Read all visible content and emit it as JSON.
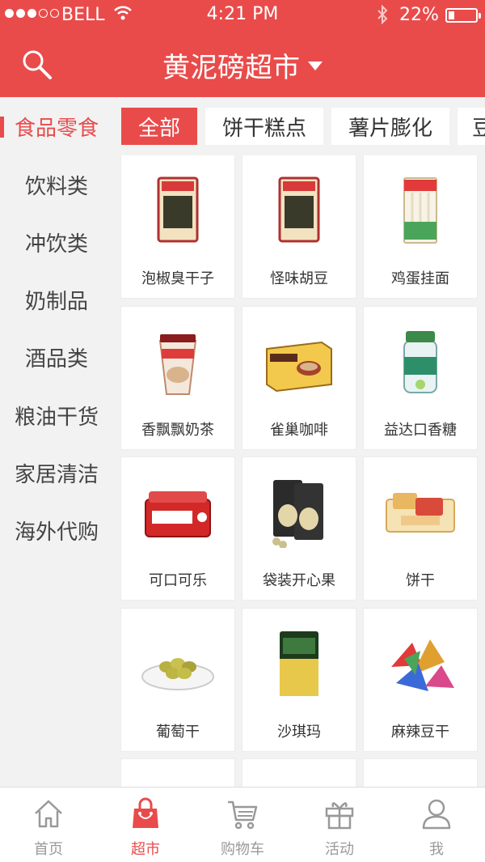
{
  "status_bar": {
    "carrier": "BELL",
    "time": "4:21 PM",
    "battery": "22%",
    "battery_level": 0.22
  },
  "header": {
    "title": "黄泥磅超市",
    "search_icon": "search-icon",
    "dropdown_icon": "caret-down-icon"
  },
  "colors": {
    "accent": "#e94b4b"
  },
  "sidebar": {
    "items": [
      {
        "label": "食品零食",
        "active": true
      },
      {
        "label": "饮料类"
      },
      {
        "label": "冲饮类"
      },
      {
        "label": "奶制品"
      },
      {
        "label": "酒品类"
      },
      {
        "label": "粮油干货"
      },
      {
        "label": "家居清洁"
      },
      {
        "label": "海外代购"
      }
    ]
  },
  "tabs": [
    {
      "label": "全部",
      "active": true
    },
    {
      "label": "饼干糕点"
    },
    {
      "label": "薯片膨化"
    },
    {
      "label": "豆"
    }
  ],
  "products": [
    {
      "name": "泡椒臭干子",
      "icon": "snack-bag-icon"
    },
    {
      "name": "怪味胡豆",
      "icon": "snack-bag-icon"
    },
    {
      "name": "鸡蛋挂面",
      "icon": "noodle-pack-icon"
    },
    {
      "name": "香飘飘奶茶",
      "icon": "milk-tea-cup-icon"
    },
    {
      "name": "雀巢咖啡",
      "icon": "coffee-box-icon"
    },
    {
      "name": "益达口香糖",
      "icon": "gum-bottle-icon"
    },
    {
      "name": "可口可乐",
      "icon": "cola-pack-icon"
    },
    {
      "name": "袋装开心果",
      "icon": "pistachio-bag-icon"
    },
    {
      "name": "饼干",
      "icon": "biscuit-icon"
    },
    {
      "name": "葡萄干",
      "icon": "raisin-plate-icon"
    },
    {
      "name": "沙琪玛",
      "icon": "sachima-bag-icon"
    },
    {
      "name": "麻辣豆干",
      "icon": "snack-pile-icon"
    }
  ],
  "tabbar": [
    {
      "label": "首页",
      "icon": "home-icon"
    },
    {
      "label": "超市",
      "icon": "shopping-bag-icon",
      "active": true
    },
    {
      "label": "购物车",
      "icon": "cart-icon"
    },
    {
      "label": "活动",
      "icon": "gift-icon"
    },
    {
      "label": "我",
      "icon": "user-icon"
    }
  ]
}
